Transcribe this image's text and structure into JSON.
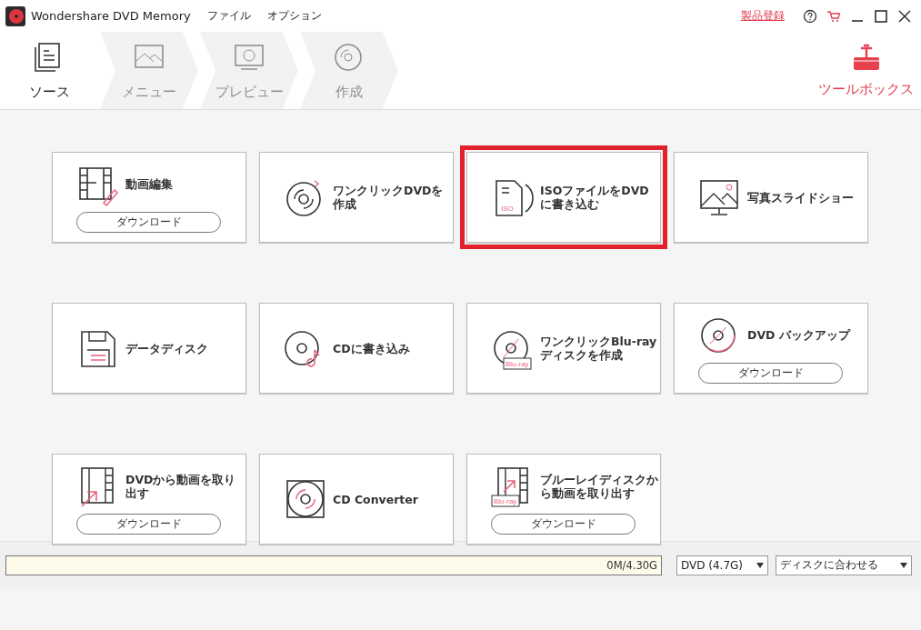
{
  "title_bar": {
    "app_name": "Wondershare DVD Memory",
    "menu": [
      "ファイル",
      "オプション"
    ],
    "register_link": "製品登録"
  },
  "steps": [
    {
      "label": "ソース",
      "disabled": false
    },
    {
      "label": "メニュー",
      "disabled": true
    },
    {
      "label": "プレビュー",
      "disabled": true
    },
    {
      "label": "作成",
      "disabled": true
    }
  ],
  "toolbox": {
    "label": "ツールボックス"
  },
  "tools": [
    {
      "title": "動画編集",
      "download": "ダウンロード",
      "selected": false
    },
    {
      "title": "ワンクリックDVDを作成",
      "selected": false
    },
    {
      "title": "ISOファイルをDVDに書き込む",
      "icon_label": "ISO",
      "selected": true
    },
    {
      "title": "写真スライドショー",
      "selected": false
    },
    {
      "title": "データディスク",
      "selected": false
    },
    {
      "title": "CDに書き込み",
      "selected": false
    },
    {
      "title": "ワンクリックBlu-rayディスクを作成",
      "icon_label": "Blu-ray",
      "selected": false
    },
    {
      "title": "DVD バックアップ",
      "download": "ダウンロード",
      "selected": false
    },
    {
      "title": "DVDから動画を取り出す",
      "download": "ダウンロード",
      "selected": false
    },
    {
      "title": "CD Converter",
      "selected": false
    },
    {
      "title": "ブルーレイディスクから動画を取り出す",
      "icon_label": "Blu-ray",
      "download": "ダウンロード",
      "selected": false
    }
  ],
  "footer": {
    "capacity": "0M/4.30G",
    "level": 0,
    "disc_type": "DVD (4.7G)",
    "fit_mode": "ディスクに合わせる"
  }
}
